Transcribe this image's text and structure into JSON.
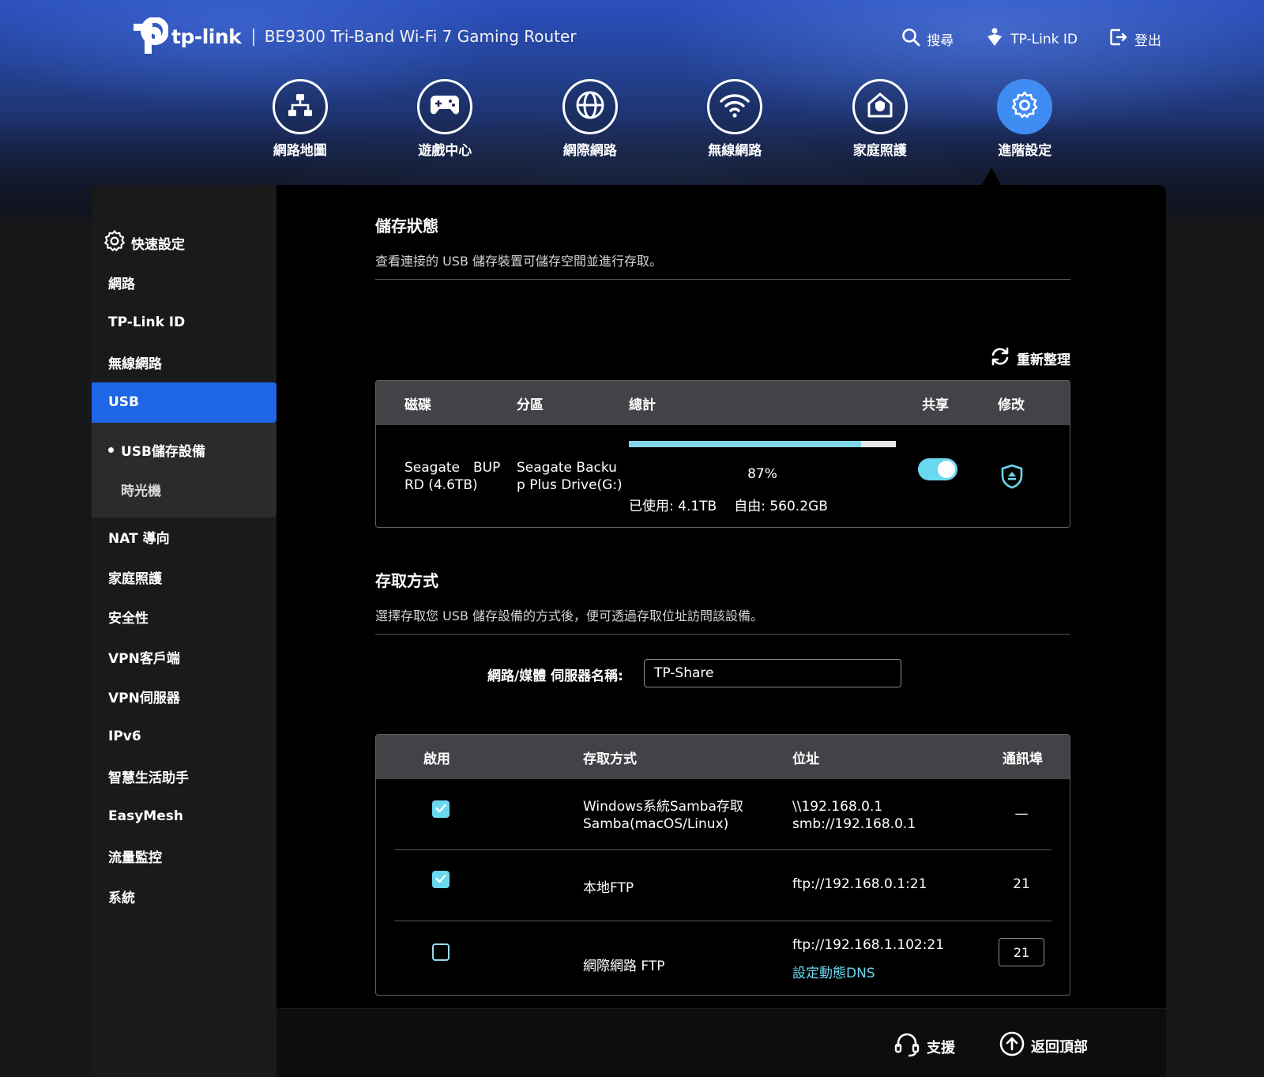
{
  "header": {
    "brand": "tp-link",
    "separator": "|",
    "product": "BE9300 Tri-Band Wi-Fi 7 Gaming Router",
    "actions": [
      {
        "icon": "search-icon",
        "label": "搜尋"
      },
      {
        "icon": "tplink-id-icon",
        "label": "TP-Link ID"
      },
      {
        "icon": "logout-icon",
        "label": "登出"
      }
    ]
  },
  "mainnav": [
    {
      "icon": "network-map-icon",
      "label": "網路地圖"
    },
    {
      "icon": "gamepad-icon",
      "label": "遊戲中心"
    },
    {
      "icon": "globe-icon",
      "label": "網際網路"
    },
    {
      "icon": "wifi-icon",
      "label": "無線網路"
    },
    {
      "icon": "home-shield-icon",
      "label": "家庭照護"
    },
    {
      "icon": "gear-icon",
      "label": "進階設定",
      "active": true
    }
  ],
  "sidebar": {
    "quick_setup": "快速設定",
    "items": [
      "網路",
      "TP-Link ID",
      "無線網路",
      "USB"
    ],
    "usb_sub": [
      "USB儲存設備",
      "時光機"
    ],
    "items_after": [
      "NAT 導向",
      "家庭照護",
      "安全性",
      "VPN客戶端",
      "VPN伺服器",
      "IPv6",
      "智慧生活助手",
      "EasyMesh",
      "流量監控",
      "系統"
    ]
  },
  "storage": {
    "title": "儲存狀態",
    "desc": "查看連接的 USB 儲存裝置可儲存空間並進行存取。",
    "refresh": "重新整理",
    "headers": {
      "disk": "磁碟",
      "partition": "分區",
      "total": "總計",
      "share": "共享",
      "modify": "修改"
    },
    "row": {
      "disk_line1": "Seagate　BUP",
      "disk_line2": "RD (4.6TB)",
      "partition_line1": "Seagate Backu",
      "partition_line2": "p Plus Drive(G:)",
      "usage_percent": 87,
      "usage_text": "87%",
      "used": "已使用: 4.1TB",
      "free": "自由: 560.2GB",
      "shared": true
    }
  },
  "access": {
    "title": "存取方式",
    "desc": "選擇存取您 USB 儲存設備的方式後，便可透過存取位址訪問該設備。",
    "server_label": "網路/媒體 伺服器名稱:",
    "server_name": "TP-Share",
    "headers": {
      "enable": "啟用",
      "method": "存取方式",
      "address": "位址",
      "port": "通訊埠"
    },
    "rows": [
      {
        "enabled": true,
        "method_line1": "Windows系統Samba存取",
        "method_line2": "Samba(macOS/Linux)",
        "addr_line1": "\\\\192.168.0.1",
        "addr_line2": "smb://192.168.0.1",
        "port": "—"
      },
      {
        "enabled": true,
        "method_line1": "本地FTP",
        "addr_line1": "ftp://192.168.0.1:21",
        "port": "21"
      },
      {
        "enabled": false,
        "method_line1": "網際網路 FTP",
        "addr_line1": "ftp://192.168.1.102:21",
        "addr_link": "設定動態DNS",
        "port": "21"
      }
    ]
  },
  "footer": {
    "support": "支援",
    "back_to_top": "返回頂部"
  },
  "colors": {
    "accent": "#1e66e6",
    "toggle": "#6ad8ef",
    "active_nav": "#3f8cf2",
    "link": "#6ad8ef"
  }
}
